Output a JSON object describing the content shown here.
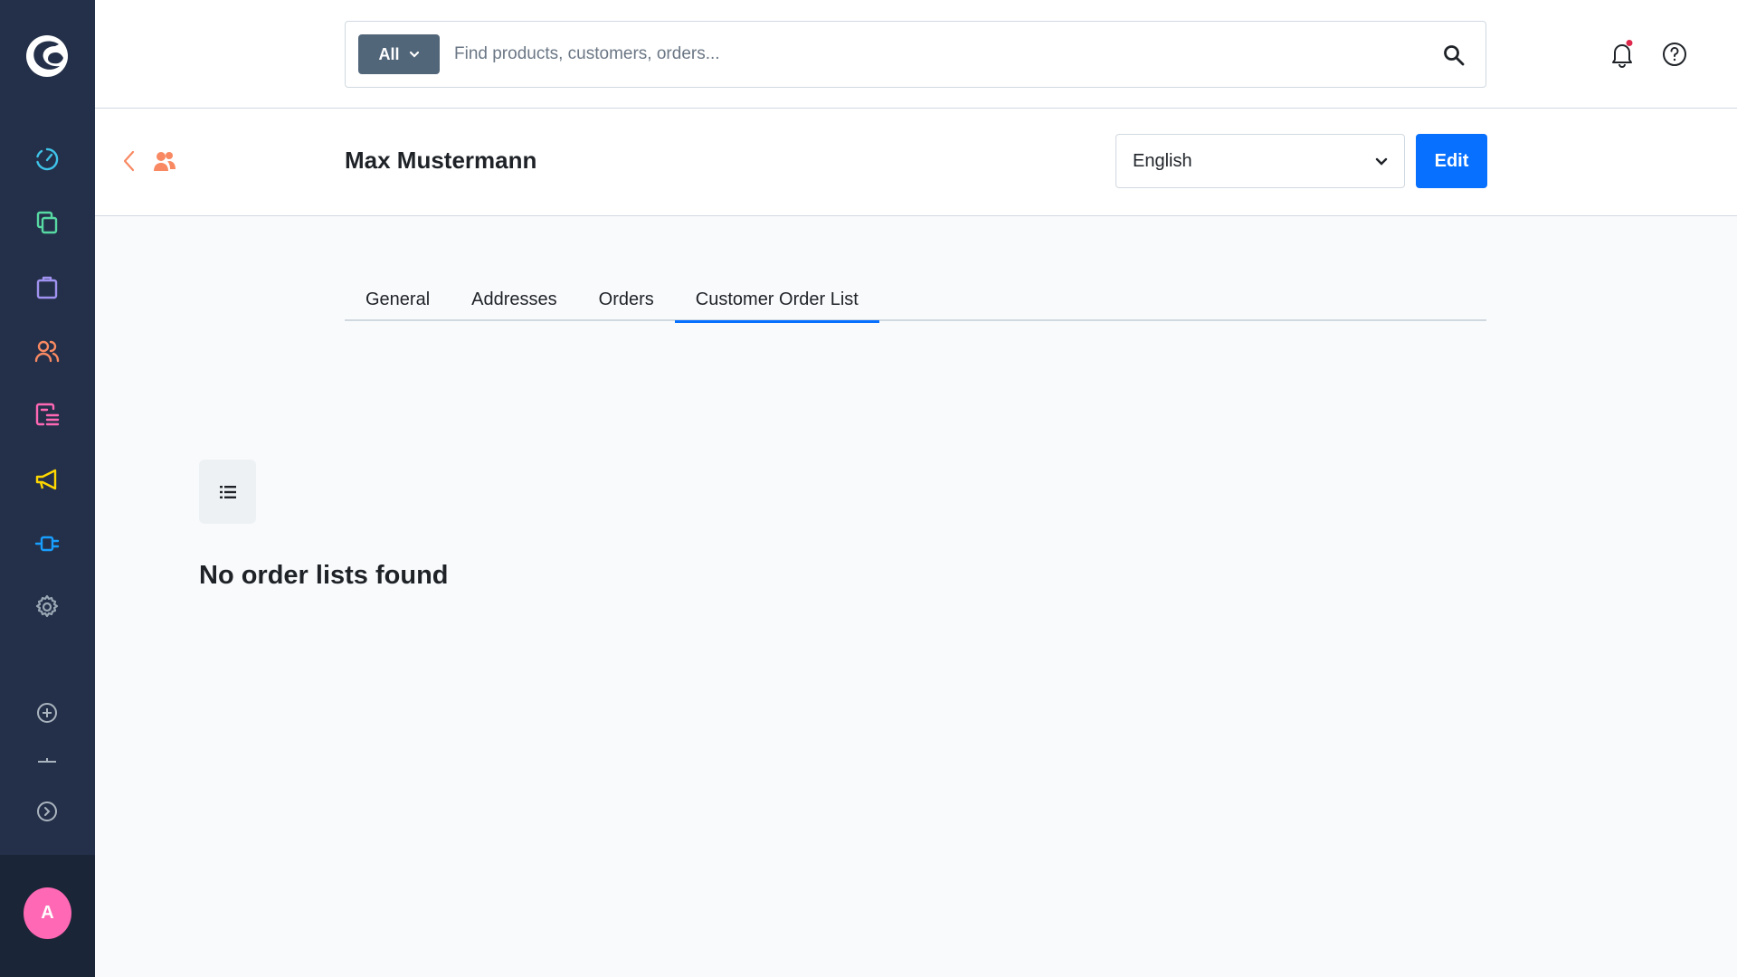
{
  "sidebar": {
    "items": [
      {
        "name": "dashboard",
        "icon": "gauge-icon",
        "color": "#3fc3e8"
      },
      {
        "name": "catalogues",
        "icon": "copy-icon",
        "color": "#57d9a3"
      },
      {
        "name": "orders",
        "icon": "shopping-bag-icon",
        "color": "#a092f0"
      },
      {
        "name": "customers",
        "icon": "users-icon",
        "color": "#f88962"
      },
      {
        "name": "content",
        "icon": "content-list-icon",
        "color": "#ff68b4"
      },
      {
        "name": "marketing",
        "icon": "megaphone-icon",
        "color": "#ffd700"
      },
      {
        "name": "extensions",
        "icon": "plug-icon",
        "color": "#189eff"
      },
      {
        "name": "settings",
        "icon": "gear-icon",
        "color": "#9aa8b5"
      }
    ],
    "avatar_initial": "A",
    "avatar_color": "#ff68b4"
  },
  "search": {
    "type_label": "All",
    "placeholder": "Find products, customers, orders..."
  },
  "header": {
    "title": "Max Mustermann",
    "language": "English",
    "edit_label": "Edit"
  },
  "tabs": [
    {
      "label": "General",
      "active": false
    },
    {
      "label": "Addresses",
      "active": false
    },
    {
      "label": "Orders",
      "active": false
    },
    {
      "label": "Customer Order List",
      "active": true
    }
  ],
  "empty_state": {
    "title": "No order lists found"
  },
  "colors": {
    "accent": "#0870ff",
    "module": "#f88962",
    "sidebar_bg": "#243049"
  }
}
